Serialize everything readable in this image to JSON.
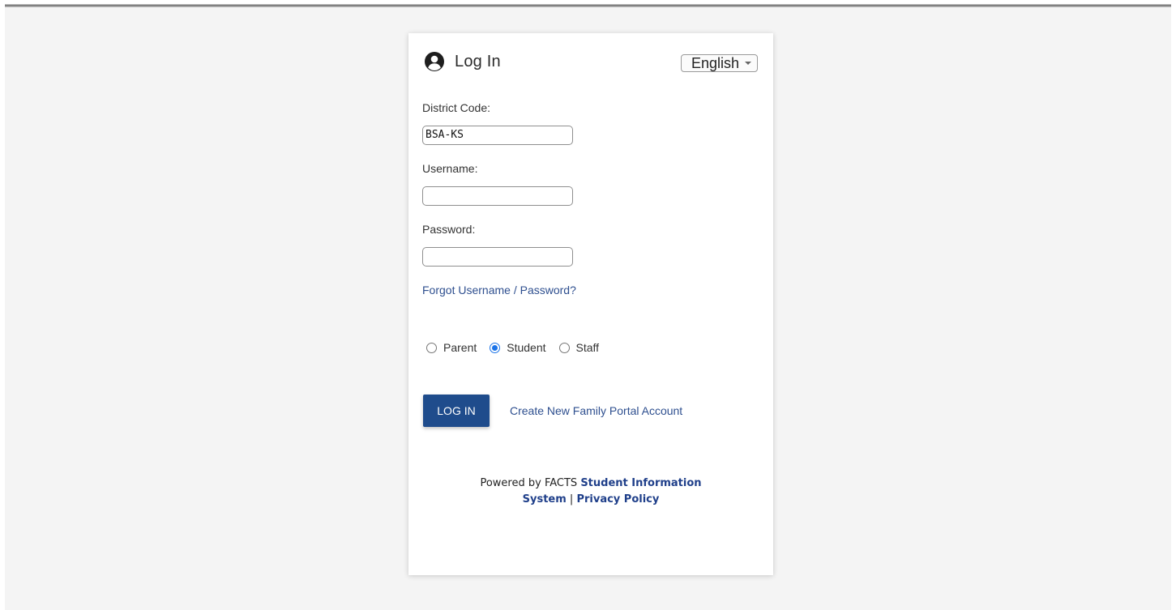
{
  "header": {
    "title": "Log In",
    "language": "English"
  },
  "form": {
    "district_label": "District Code:",
    "district_value": "BSA-KS",
    "username_label": "Username:",
    "username_value": "",
    "password_label": "Password:",
    "password_value": "",
    "forgot_link": "Forgot Username / Password?"
  },
  "roles": [
    {
      "label": "Parent",
      "selected": false
    },
    {
      "label": "Student",
      "selected": true
    },
    {
      "label": "Staff",
      "selected": false
    }
  ],
  "actions": {
    "login_button": "LOG IN",
    "create_account_link": "Create New Family Portal Account"
  },
  "footer": {
    "powered_by": "Powered by FACTS",
    "sis_link_part1": "Student Information",
    "sis_link_part2": "System",
    "separator": "|",
    "privacy_link": "Privacy Policy"
  },
  "colors": {
    "primary": "#1f4c8c",
    "link": "#2e4f8f",
    "radio_selected": "#1a73e8",
    "background": "#f4f4f4"
  },
  "icons": {
    "header_icon": "user-circle-icon"
  }
}
